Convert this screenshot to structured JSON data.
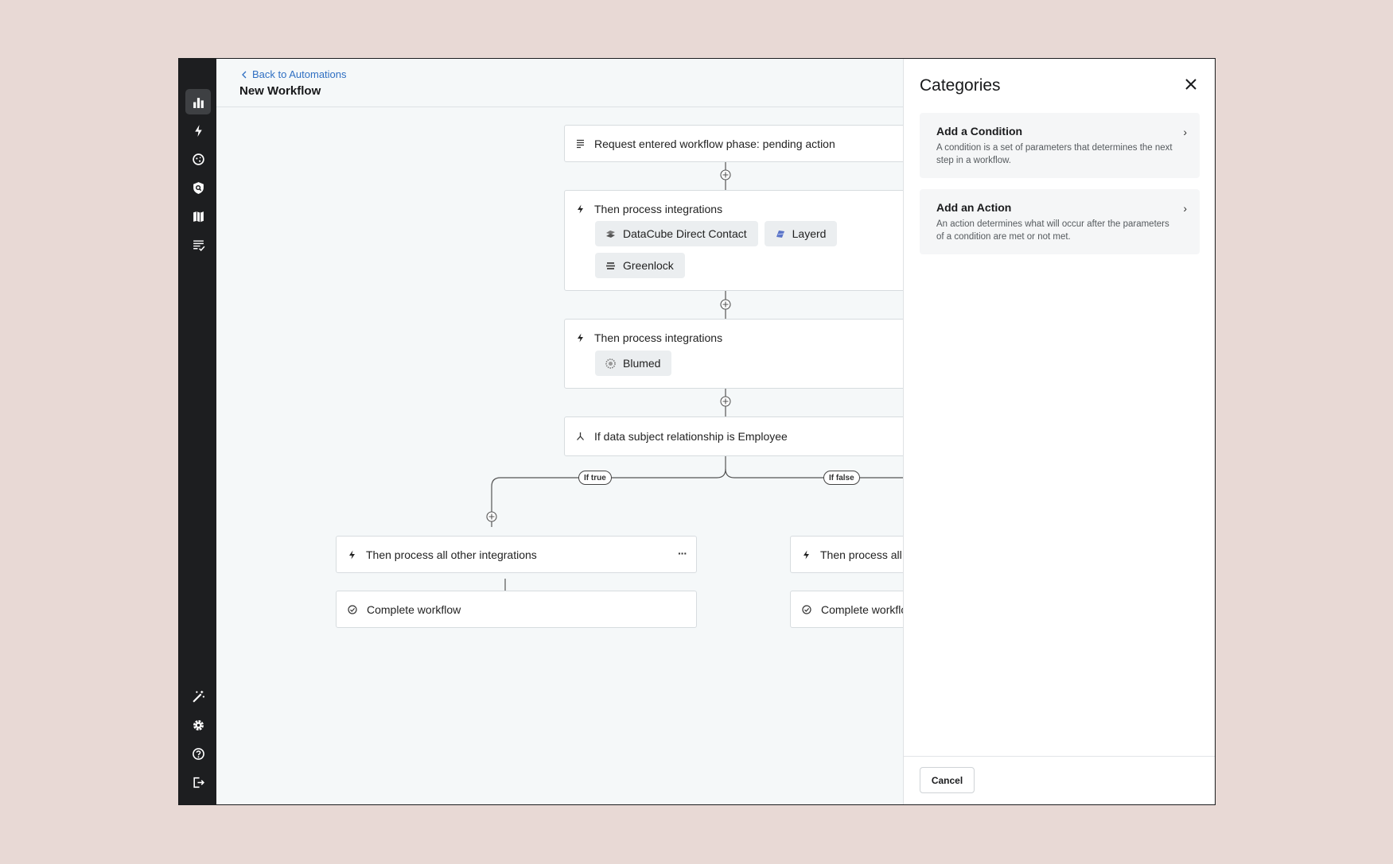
{
  "header": {
    "back_link": "Back to Automations",
    "title": "New Workflow"
  },
  "sidebar": {
    "top_icons": [
      "analytics-icon",
      "bolt-icon",
      "cookie-icon",
      "shield-search-icon",
      "map-icon",
      "checklist-icon"
    ],
    "bottom_icons": [
      "magic-wand-icon",
      "gear-icon",
      "help-icon",
      "logout-icon"
    ]
  },
  "workflow": {
    "trigger": {
      "label": "Request entered workflow phase: pending action"
    },
    "step1": {
      "label": "Then process integrations",
      "chips": [
        "DataCube Direct Contact",
        "Layerd",
        "Greenlock"
      ]
    },
    "step2": {
      "label": "Then process integrations",
      "chips": [
        "Blumed"
      ]
    },
    "condition": {
      "label": "If data subject relationship is Employee"
    },
    "branch_true": "If true",
    "branch_false": "If false",
    "left_branch": {
      "action": "Then process all other integrations",
      "complete": "Complete workflow"
    },
    "right_branch": {
      "action": "Then process all other integrations",
      "complete": "Complete workflow"
    },
    "menu_glyph": "···"
  },
  "panel": {
    "title": "Categories",
    "cards": [
      {
        "title": "Add a Condition",
        "desc": "A condition is a set of parameters that determines the next step in a workflow."
      },
      {
        "title": "Add an Action",
        "desc": "An action determines what will occur after the parameters of a condition are met or not met."
      }
    ],
    "cancel": "Cancel"
  },
  "colors": {
    "link": "#2f6fc2",
    "rail": "#1d1e20",
    "backdrop": "#e8d9d5"
  }
}
